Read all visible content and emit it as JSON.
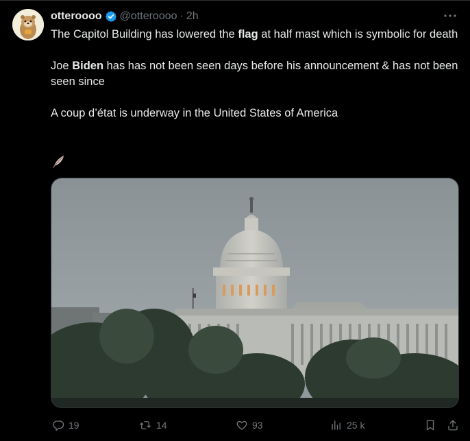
{
  "author": {
    "display_name": "otteroooo",
    "handle": "@otteroooo",
    "separator": "·",
    "timestamp": "2h",
    "verified": true,
    "verified_color": "#1d9bf0"
  },
  "tweet": {
    "paragraphs": [
      {
        "segments": [
          {
            "text": "The Capitol Building has lowered the ",
            "bold": false
          },
          {
            "text": "flag",
            "bold": true
          },
          {
            "text": " at half mast which is symbolic for death",
            "bold": false
          }
        ]
      },
      {
        "segments": [
          {
            "text": "Joe ",
            "bold": false
          },
          {
            "text": "Biden",
            "bold": true
          },
          {
            "text": " has has not been seen days before his announcement & has not been seen since",
            "bold": false
          }
        ]
      },
      {
        "segments": [
          {
            "text": "A coup d’état is underway in the United States of America",
            "bold": false
          }
        ]
      }
    ],
    "emoji": "feather-emoji",
    "media": {
      "type": "photo",
      "subject": "capitol-building-photo"
    }
  },
  "actions": {
    "reply_count": "19",
    "retweet_count": "14",
    "like_count": "93",
    "view_count": "25 k"
  },
  "icons": {
    "more": "more-icon",
    "reply": "reply-icon",
    "retweet": "retweet-icon",
    "like": "heart-icon",
    "views": "views-icon",
    "bookmark": "bookmark-icon",
    "share": "share-icon"
  },
  "colors": {
    "background": "#000000",
    "text_primary": "#e7e9ea",
    "text_secondary": "#71767b",
    "border": "#2f3336"
  }
}
